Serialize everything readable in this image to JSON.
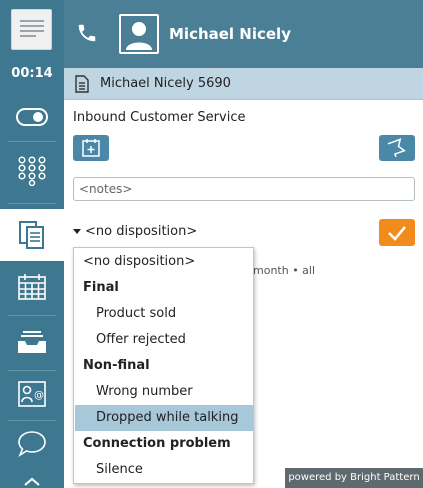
{
  "sidebar": {
    "timer": "00:14",
    "icons": [
      "logo-icon",
      "toggle-icon",
      "dialpad-icon",
      "documents-icon",
      "calendar-icon",
      "inbox-icon",
      "contacts-icon",
      "chat-icon",
      "expand-icon"
    ],
    "accent": "#3e7890"
  },
  "header": {
    "agent_name": "Michael Nicely",
    "icons": [
      "phone-icon",
      "avatar-icon"
    ]
  },
  "panel": {
    "title": "Michael Nicely 5690",
    "service": "Inbound Customer Service",
    "notes_placeholder": "<notes>",
    "disposition_selected": "<no disposition>",
    "behind_text": "month • all"
  },
  "dropdown": {
    "items": [
      {
        "label": "<no disposition>",
        "kind": "plain"
      },
      {
        "label": "Final",
        "kind": "header"
      },
      {
        "label": "Product sold",
        "kind": "option"
      },
      {
        "label": "Offer rejected",
        "kind": "option"
      },
      {
        "label": "Non-final",
        "kind": "header"
      },
      {
        "label": "Wrong number",
        "kind": "option"
      },
      {
        "label": "Dropped while talking",
        "kind": "option",
        "highlighted": true
      },
      {
        "label": "Connection problem",
        "kind": "header"
      },
      {
        "label": "Silence",
        "kind": "option"
      }
    ]
  },
  "footer": {
    "powered_by": "powered by Bright Pattern"
  },
  "colors": {
    "header_bg": "#4a7f96",
    "titlebar_bg": "#bfd6e2",
    "confirm_button": "#f28a1c",
    "highlight": "#a7c8d8"
  }
}
